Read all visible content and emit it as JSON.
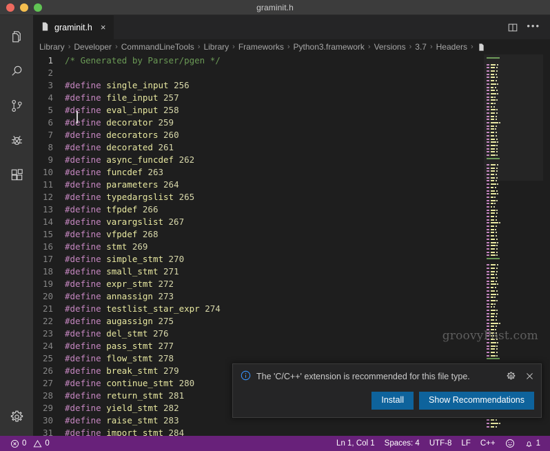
{
  "window": {
    "title": "graminit.h",
    "traffic_lights": [
      "close-red",
      "minimize-yellow",
      "maximize-green"
    ]
  },
  "activitybar": {
    "items": [
      {
        "name": "explorer",
        "icon": "files-icon",
        "label": "Explorer"
      },
      {
        "name": "search",
        "icon": "search-icon",
        "label": "Search"
      },
      {
        "name": "source-control",
        "icon": "source-control-icon",
        "label": "Source Control"
      },
      {
        "name": "run-debug",
        "icon": "debug-icon",
        "label": "Run and Debug"
      },
      {
        "name": "extensions",
        "icon": "extensions-icon",
        "label": "Extensions"
      }
    ],
    "bottom": [
      {
        "name": "manage",
        "icon": "gear-icon",
        "label": "Manage"
      }
    ]
  },
  "tabbar": {
    "tabs": [
      {
        "label": "graminit.h",
        "icon": "file-icon",
        "close": "×",
        "active": true
      }
    ],
    "actions": [
      {
        "name": "split-editor",
        "icon": "split-editor-icon"
      },
      {
        "name": "more-actions",
        "icon": "ellipsis-icon",
        "glyph": "•••"
      }
    ]
  },
  "breadcrumbs": {
    "separator": "›",
    "items": [
      "Library",
      "Developer",
      "CommandLineTools",
      "Library",
      "Frameworks",
      "Python3.framework",
      "Versions",
      "3.7",
      "Headers"
    ],
    "trailing_icon": "file-icon"
  },
  "editor": {
    "language": "C++",
    "cursor_line": 1,
    "lines": [
      {
        "n": "1",
        "type": "comment",
        "text": "/* Generated by Parser/pgen */"
      },
      {
        "n": "2",
        "type": "blank",
        "text": ""
      },
      {
        "n": "3",
        "type": "define",
        "kw": "#define",
        "ident": "single_input",
        "num": "256"
      },
      {
        "n": "4",
        "type": "define",
        "kw": "#define",
        "ident": "file_input",
        "num": "257"
      },
      {
        "n": "5",
        "type": "define",
        "kw": "#define",
        "ident": "eval_input",
        "num": "258"
      },
      {
        "n": "6",
        "type": "define",
        "kw": "#define",
        "ident": "decorator",
        "num": "259"
      },
      {
        "n": "7",
        "type": "define",
        "kw": "#define",
        "ident": "decorators",
        "num": "260"
      },
      {
        "n": "8",
        "type": "define",
        "kw": "#define",
        "ident": "decorated",
        "num": "261"
      },
      {
        "n": "9",
        "type": "define",
        "kw": "#define",
        "ident": "async_funcdef",
        "num": "262"
      },
      {
        "n": "10",
        "type": "define",
        "kw": "#define",
        "ident": "funcdef",
        "num": "263"
      },
      {
        "n": "11",
        "type": "define",
        "kw": "#define",
        "ident": "parameters",
        "num": "264"
      },
      {
        "n": "12",
        "type": "define",
        "kw": "#define",
        "ident": "typedargslist",
        "num": "265"
      },
      {
        "n": "13",
        "type": "define",
        "kw": "#define",
        "ident": "tfpdef",
        "num": "266"
      },
      {
        "n": "14",
        "type": "define",
        "kw": "#define",
        "ident": "varargslist",
        "num": "267"
      },
      {
        "n": "15",
        "type": "define",
        "kw": "#define",
        "ident": "vfpdef",
        "num": "268"
      },
      {
        "n": "16",
        "type": "define",
        "kw": "#define",
        "ident": "stmt",
        "num": "269"
      },
      {
        "n": "17",
        "type": "define",
        "kw": "#define",
        "ident": "simple_stmt",
        "num": "270"
      },
      {
        "n": "18",
        "type": "define",
        "kw": "#define",
        "ident": "small_stmt",
        "num": "271"
      },
      {
        "n": "19",
        "type": "define",
        "kw": "#define",
        "ident": "expr_stmt",
        "num": "272"
      },
      {
        "n": "20",
        "type": "define",
        "kw": "#define",
        "ident": "annassign",
        "num": "273"
      },
      {
        "n": "21",
        "type": "define",
        "kw": "#define",
        "ident": "testlist_star_expr",
        "num": "274"
      },
      {
        "n": "22",
        "type": "define",
        "kw": "#define",
        "ident": "augassign",
        "num": "275"
      },
      {
        "n": "23",
        "type": "define",
        "kw": "#define",
        "ident": "del_stmt",
        "num": "276"
      },
      {
        "n": "24",
        "type": "define",
        "kw": "#define",
        "ident": "pass_stmt",
        "num": "277"
      },
      {
        "n": "25",
        "type": "define",
        "kw": "#define",
        "ident": "flow_stmt",
        "num": "278"
      },
      {
        "n": "26",
        "type": "define",
        "kw": "#define",
        "ident": "break_stmt",
        "num": "279"
      },
      {
        "n": "27",
        "type": "define",
        "kw": "#define",
        "ident": "continue_stmt",
        "num": "280"
      },
      {
        "n": "28",
        "type": "define",
        "kw": "#define",
        "ident": "return_stmt",
        "num": "281"
      },
      {
        "n": "29",
        "type": "define",
        "kw": "#define",
        "ident": "yield_stmt",
        "num": "282"
      },
      {
        "n": "30",
        "type": "define",
        "kw": "#define",
        "ident": "raise_stmt",
        "num": "283"
      },
      {
        "n": "31",
        "type": "define",
        "kw": "#define",
        "ident": "import_stmt",
        "num": "284"
      }
    ]
  },
  "watermark": {
    "text": "groovyPost.com"
  },
  "notification": {
    "icon": "info-icon",
    "message": "The 'C/C++' extension is recommended for this file type.",
    "gear_icon": "gear-icon",
    "close_icon": "close-icon",
    "buttons": [
      {
        "label": "Install",
        "name": "install-button"
      },
      {
        "label": "Show Recommendations",
        "name": "show-recommendations-button"
      }
    ]
  },
  "statusbar": {
    "background": "#68217a",
    "errors": {
      "icon": "error-icon",
      "count": "0"
    },
    "warnings": {
      "icon": "warning-icon",
      "count": "0"
    },
    "right": [
      {
        "name": "cursor-position",
        "label": "Ln 1, Col 1"
      },
      {
        "name": "indentation",
        "label": "Spaces: 4"
      },
      {
        "name": "encoding",
        "label": "UTF-8"
      },
      {
        "name": "eol",
        "label": "LF"
      },
      {
        "name": "language-mode",
        "label": "C++"
      }
    ],
    "feedback_icon": "smiley-icon",
    "notifications": {
      "icon": "bell-icon",
      "count": "1"
    }
  },
  "colors": {
    "accent": "#0e639c",
    "statusbar": "#68217a",
    "editor_bg": "#1e1e1e",
    "activitybar_bg": "#333333",
    "comment": "#6a9955",
    "keyword": "#c586c0",
    "identifier": "#e8e8a0",
    "number": "#d7d7aa"
  }
}
